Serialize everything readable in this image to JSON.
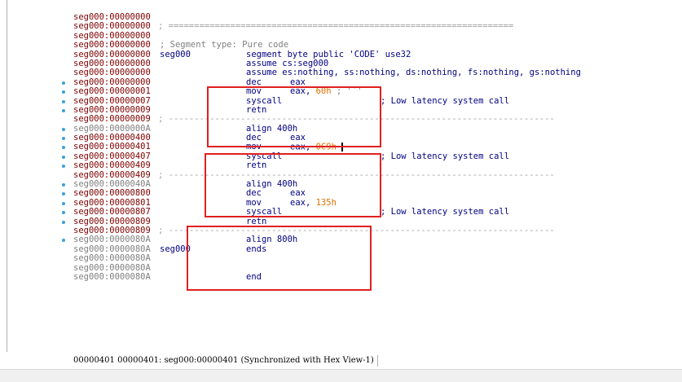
{
  "lines": [
    {
      "addr": "seg000:00000000"
    },
    {
      "addr": "seg000:00000000",
      "sep": "; ==================================================================="
    },
    {
      "addr": "seg000:00000000"
    },
    {
      "addr": "seg000:00000000",
      "comment": "; Segment type: Pure code"
    },
    {
      "addr": "seg000:00000000",
      "label": "seg000",
      "mnem": "segment byte public 'CODE' use32"
    },
    {
      "addr": "seg000:00000000",
      "mnem": "assume cs:seg000"
    },
    {
      "addr": "seg000:00000000",
      "mnem": "assume es:nothing, ss:nothing, ds:nothing, fs:nothing, gs:nothing"
    },
    {
      "addr": "seg000:00000000",
      "mnem": "dec",
      "op": "eax",
      "dot": true
    },
    {
      "addr": "seg000:00000001",
      "mnem": "mov",
      "op": "eax, ",
      "num": "60h",
      "tail": " ; '`'",
      "dot": true
    },
    {
      "addr": "seg000:00000007",
      "mnem": "syscall",
      "cmt": "; Low latency system call",
      "dot": true
    },
    {
      "addr": "seg000:00000009",
      "mnem": "retn",
      "dot": true
    },
    {
      "addr": "seg000:00000009",
      "sep": "; ---------------------------------------------------------------------------"
    },
    {
      "addr": "seg000:0000000A",
      "gray": true,
      "mnem": "align 400h",
      "dot": true
    },
    {
      "addr": "seg000:00000400",
      "mnem": "dec",
      "op": "eax",
      "dot": true
    },
    {
      "addr": "seg000:00000401",
      "mnem": "mov",
      "op": "eax, ",
      "num": "0C9h",
      "cursor": true,
      "dot": true
    },
    {
      "addr": "seg000:00000407",
      "mnem": "syscall",
      "cmt": "; Low latency system call",
      "dot": true
    },
    {
      "addr": "seg000:00000409",
      "mnem": "retn",
      "dot": true
    },
    {
      "addr": "seg000:00000409",
      "sep": "; ---------------------------------------------------------------------------"
    },
    {
      "addr": "seg000:0000040A",
      "gray": true,
      "mnem": "align 400h",
      "dot": true
    },
    {
      "addr": "seg000:00000800",
      "mnem": "dec",
      "op": "eax",
      "dot": true
    },
    {
      "addr": "seg000:00000801",
      "mnem": "mov",
      "op": "eax, ",
      "num": "135h",
      "dot": true
    },
    {
      "addr": "seg000:00000807",
      "mnem": "syscall",
      "cmt": "; Low latency system call",
      "dot": true
    },
    {
      "addr": "seg000:00000809",
      "mnem": "retn",
      "dot": true
    },
    {
      "addr": "seg000:00000809",
      "sep": "; ---------------------------------------------------------------------------"
    },
    {
      "addr": "seg000:0000080A",
      "gray": true,
      "mnem": "align 800h",
      "dot": true
    },
    {
      "addr": "seg000:0000080A",
      "gray": true,
      "label": "seg000",
      "mnem": "ends"
    },
    {
      "addr": "seg000:0000080A",
      "gray": true
    },
    {
      "addr": "seg000:0000080A",
      "gray": true
    },
    {
      "addr": "seg000:0000080A",
      "gray": true,
      "mnem": "end"
    }
  ],
  "status_text": "00000401 00000401: seg000:00000401 (Synchronized with Hex View-1)"
}
